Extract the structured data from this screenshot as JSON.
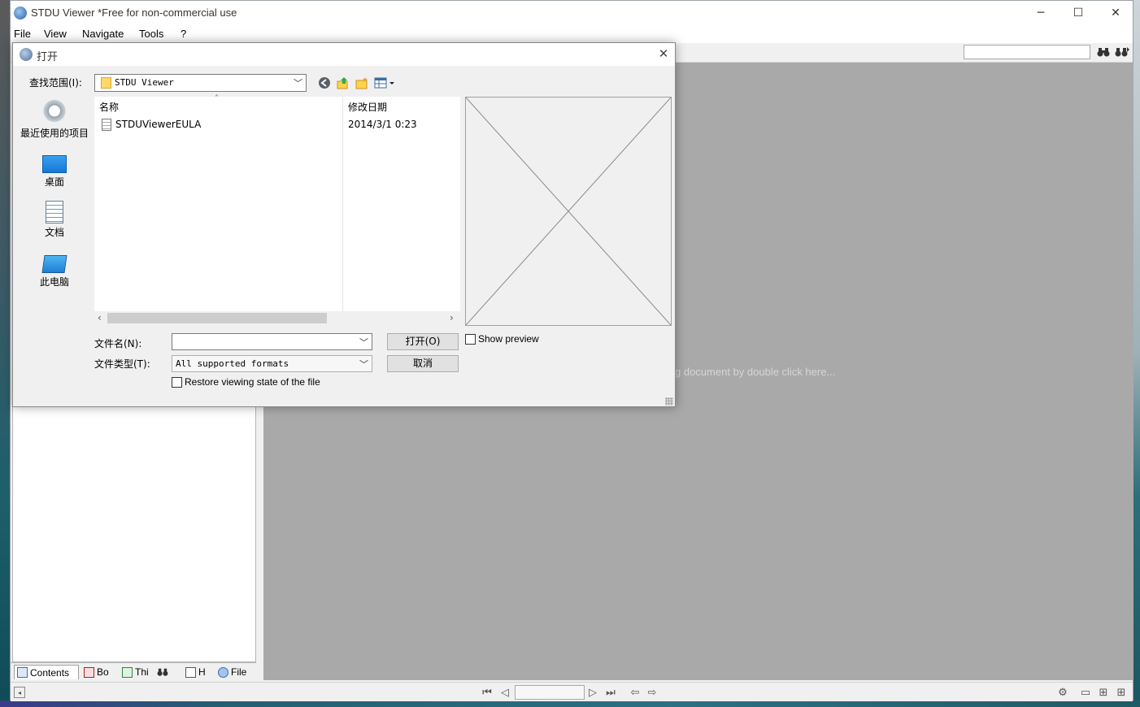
{
  "window": {
    "title": "STDU Viewer *Free for non-commercial use",
    "minimize_glyph": "─",
    "maximize_glyph": "☐",
    "close_glyph": "✕"
  },
  "menu": [
    {
      "label": "File"
    },
    {
      "label": "View"
    },
    {
      "label": "Navigate"
    },
    {
      "label": "Tools"
    },
    {
      "label": "?"
    }
  ],
  "toolbar": {
    "search_value": "",
    "find_icon": "binoculars-icon",
    "find_next_icon": "binoculars-next-icon"
  },
  "document_area": {
    "hint": "g document by double click here..."
  },
  "panel_tabs": [
    {
      "label": "Contents",
      "icon": "contents-icon"
    },
    {
      "label": "Bo",
      "icon": "bookmarks-icon"
    },
    {
      "label": "Thi",
      "icon": "thumbnails-icon"
    },
    {
      "label": "",
      "icon": "search-binoculars-icon"
    },
    {
      "label": "H",
      "icon": "highlights-icon"
    },
    {
      "label": "File",
      "icon": "file-icon"
    }
  ],
  "statusbar": {
    "page_value": ""
  },
  "dialog": {
    "title": "打开",
    "look_in_label": "查找范围(I):",
    "look_in_value": "STDU Viewer",
    "places": [
      {
        "label": "最近使用的项目",
        "icon": "recent-items-icon"
      },
      {
        "label": "桌面",
        "icon": "desktop-icon"
      },
      {
        "label": "文档",
        "icon": "documents-icon"
      },
      {
        "label": "此电脑",
        "icon": "this-pc-icon"
      }
    ],
    "columns": {
      "name": "名称",
      "date": "修改日期"
    },
    "files": [
      {
        "name": "STDUViewerEULA",
        "date": "2014/3/1 0:23"
      }
    ],
    "file_name_label": "文件名(N):",
    "file_name_value": "",
    "file_type_label": "文件类型(T):",
    "file_type_value": "All supported formats",
    "open_button": "打开(O)",
    "cancel_button": "取消",
    "show_preview_label": "Show preview",
    "restore_label": "Restore viewing state of the file"
  }
}
